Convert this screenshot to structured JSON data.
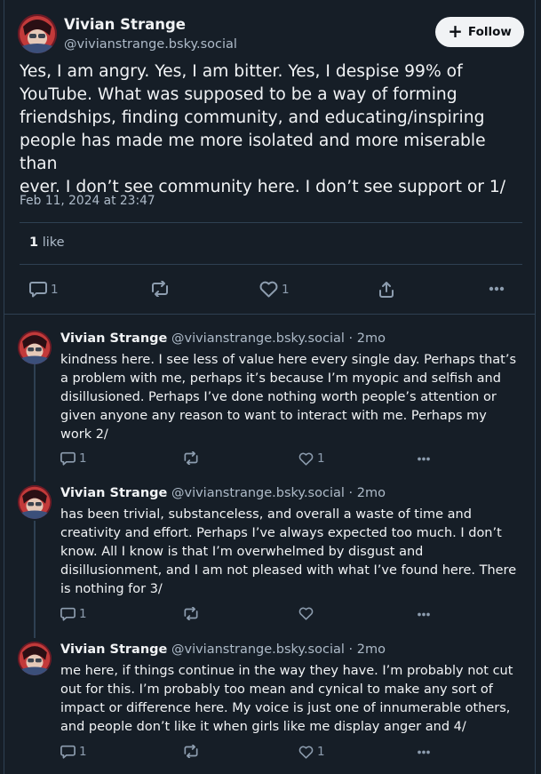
{
  "main_post": {
    "author_name": "Vivian Strange",
    "author_handle": "@vivianstrange.bsky.social",
    "follow_label": "Follow",
    "follow_icon": "plus-icon",
    "text": "Yes, I am angry. Yes, I am bitter. Yes, I despise 99% of\nYouTube. What was supposed to be a way of forming\nfriendships, finding community, and educating/inspiring\npeople has made me more isolated and more miserable than\never. I don’t see community here. I don’t see support or 1/",
    "timestamp": "Feb 11, 2024 at 23:47",
    "likes_count": "1",
    "likes_label": "like",
    "reply_count": "1",
    "like_count": "1"
  },
  "replies": [
    {
      "author_name": "Vivian Strange",
      "author_handle": "@vivianstrange.bsky.social",
      "age": "2mo",
      "text": "kindness here. I see less of value here every single day. Perhaps that’s\na problem with me, perhaps it’s because I’m myopic and selfish and\ndisillusioned. Perhaps I’ve done nothing worth people’s attention or\ngiven anyone any reason to want to interact with me. Perhaps my\nwork 2/",
      "reply_count": "1",
      "like_count": "1"
    },
    {
      "author_name": "Vivian Strange",
      "author_handle": "@vivianstrange.bsky.social",
      "age": "2mo",
      "text": "has been trivial, substanceless, and overall a waste of time and\ncreativity and effort. Perhaps I’ve always expected too much. I don’t\nknow. All I know is that I’m overwhelmed by disgust and\ndisillusionment, and I am not pleased with what I’ve found here. There\nis nothing for 3/",
      "reply_count": "1",
      "like_count": ""
    },
    {
      "author_name": "Vivian Strange",
      "author_handle": "@vivianstrange.bsky.social",
      "age": "2mo",
      "text": "me here, if things continue in the way they have. I’m probably not cut\nout for this. I’m probably too mean and cynical to make any sort of\nimpact or difference here. My voice is just one of innumerable others,\nand people don’t like it when girls like me display anger and 4/",
      "reply_count": "1",
      "like_count": "1"
    }
  ],
  "colors": {
    "background": "#161e27",
    "border": "#2e4052",
    "text": "#f1f3f5",
    "muted": "#aebbc9",
    "icon": "#8d9daf"
  }
}
